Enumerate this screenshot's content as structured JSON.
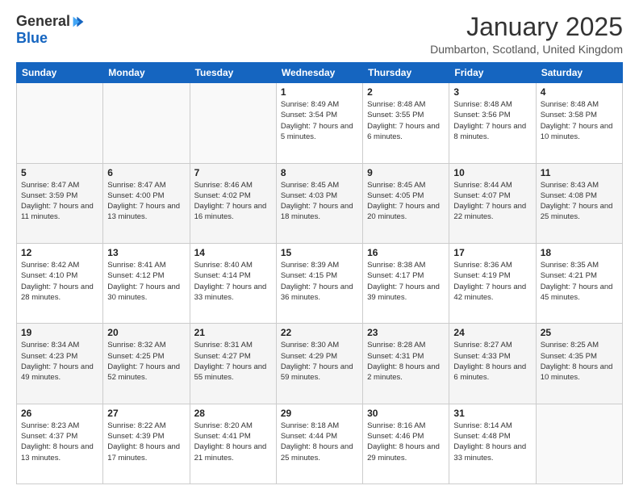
{
  "logo": {
    "general": "General",
    "blue": "Blue"
  },
  "title": "January 2025",
  "location": "Dumbarton, Scotland, United Kingdom",
  "days_of_week": [
    "Sunday",
    "Monday",
    "Tuesday",
    "Wednesday",
    "Thursday",
    "Friday",
    "Saturday"
  ],
  "weeks": [
    [
      {
        "day": "",
        "sunrise": "",
        "sunset": "",
        "daylight": ""
      },
      {
        "day": "",
        "sunrise": "",
        "sunset": "",
        "daylight": ""
      },
      {
        "day": "",
        "sunrise": "",
        "sunset": "",
        "daylight": ""
      },
      {
        "day": "1",
        "sunrise": "Sunrise: 8:49 AM",
        "sunset": "Sunset: 3:54 PM",
        "daylight": "Daylight: 7 hours and 5 minutes."
      },
      {
        "day": "2",
        "sunrise": "Sunrise: 8:48 AM",
        "sunset": "Sunset: 3:55 PM",
        "daylight": "Daylight: 7 hours and 6 minutes."
      },
      {
        "day": "3",
        "sunrise": "Sunrise: 8:48 AM",
        "sunset": "Sunset: 3:56 PM",
        "daylight": "Daylight: 7 hours and 8 minutes."
      },
      {
        "day": "4",
        "sunrise": "Sunrise: 8:48 AM",
        "sunset": "Sunset: 3:58 PM",
        "daylight": "Daylight: 7 hours and 10 minutes."
      }
    ],
    [
      {
        "day": "5",
        "sunrise": "Sunrise: 8:47 AM",
        "sunset": "Sunset: 3:59 PM",
        "daylight": "Daylight: 7 hours and 11 minutes."
      },
      {
        "day": "6",
        "sunrise": "Sunrise: 8:47 AM",
        "sunset": "Sunset: 4:00 PM",
        "daylight": "Daylight: 7 hours and 13 minutes."
      },
      {
        "day": "7",
        "sunrise": "Sunrise: 8:46 AM",
        "sunset": "Sunset: 4:02 PM",
        "daylight": "Daylight: 7 hours and 16 minutes."
      },
      {
        "day": "8",
        "sunrise": "Sunrise: 8:45 AM",
        "sunset": "Sunset: 4:03 PM",
        "daylight": "Daylight: 7 hours and 18 minutes."
      },
      {
        "day": "9",
        "sunrise": "Sunrise: 8:45 AM",
        "sunset": "Sunset: 4:05 PM",
        "daylight": "Daylight: 7 hours and 20 minutes."
      },
      {
        "day": "10",
        "sunrise": "Sunrise: 8:44 AM",
        "sunset": "Sunset: 4:07 PM",
        "daylight": "Daylight: 7 hours and 22 minutes."
      },
      {
        "day": "11",
        "sunrise": "Sunrise: 8:43 AM",
        "sunset": "Sunset: 4:08 PM",
        "daylight": "Daylight: 7 hours and 25 minutes."
      }
    ],
    [
      {
        "day": "12",
        "sunrise": "Sunrise: 8:42 AM",
        "sunset": "Sunset: 4:10 PM",
        "daylight": "Daylight: 7 hours and 28 minutes."
      },
      {
        "day": "13",
        "sunrise": "Sunrise: 8:41 AM",
        "sunset": "Sunset: 4:12 PM",
        "daylight": "Daylight: 7 hours and 30 minutes."
      },
      {
        "day": "14",
        "sunrise": "Sunrise: 8:40 AM",
        "sunset": "Sunset: 4:14 PM",
        "daylight": "Daylight: 7 hours and 33 minutes."
      },
      {
        "day": "15",
        "sunrise": "Sunrise: 8:39 AM",
        "sunset": "Sunset: 4:15 PM",
        "daylight": "Daylight: 7 hours and 36 minutes."
      },
      {
        "day": "16",
        "sunrise": "Sunrise: 8:38 AM",
        "sunset": "Sunset: 4:17 PM",
        "daylight": "Daylight: 7 hours and 39 minutes."
      },
      {
        "day": "17",
        "sunrise": "Sunrise: 8:36 AM",
        "sunset": "Sunset: 4:19 PM",
        "daylight": "Daylight: 7 hours and 42 minutes."
      },
      {
        "day": "18",
        "sunrise": "Sunrise: 8:35 AM",
        "sunset": "Sunset: 4:21 PM",
        "daylight": "Daylight: 7 hours and 45 minutes."
      }
    ],
    [
      {
        "day": "19",
        "sunrise": "Sunrise: 8:34 AM",
        "sunset": "Sunset: 4:23 PM",
        "daylight": "Daylight: 7 hours and 49 minutes."
      },
      {
        "day": "20",
        "sunrise": "Sunrise: 8:32 AM",
        "sunset": "Sunset: 4:25 PM",
        "daylight": "Daylight: 7 hours and 52 minutes."
      },
      {
        "day": "21",
        "sunrise": "Sunrise: 8:31 AM",
        "sunset": "Sunset: 4:27 PM",
        "daylight": "Daylight: 7 hours and 55 minutes."
      },
      {
        "day": "22",
        "sunrise": "Sunrise: 8:30 AM",
        "sunset": "Sunset: 4:29 PM",
        "daylight": "Daylight: 7 hours and 59 minutes."
      },
      {
        "day": "23",
        "sunrise": "Sunrise: 8:28 AM",
        "sunset": "Sunset: 4:31 PM",
        "daylight": "Daylight: 8 hours and 2 minutes."
      },
      {
        "day": "24",
        "sunrise": "Sunrise: 8:27 AM",
        "sunset": "Sunset: 4:33 PM",
        "daylight": "Daylight: 8 hours and 6 minutes."
      },
      {
        "day": "25",
        "sunrise": "Sunrise: 8:25 AM",
        "sunset": "Sunset: 4:35 PM",
        "daylight": "Daylight: 8 hours and 10 minutes."
      }
    ],
    [
      {
        "day": "26",
        "sunrise": "Sunrise: 8:23 AM",
        "sunset": "Sunset: 4:37 PM",
        "daylight": "Daylight: 8 hours and 13 minutes."
      },
      {
        "day": "27",
        "sunrise": "Sunrise: 8:22 AM",
        "sunset": "Sunset: 4:39 PM",
        "daylight": "Daylight: 8 hours and 17 minutes."
      },
      {
        "day": "28",
        "sunrise": "Sunrise: 8:20 AM",
        "sunset": "Sunset: 4:41 PM",
        "daylight": "Daylight: 8 hours and 21 minutes."
      },
      {
        "day": "29",
        "sunrise": "Sunrise: 8:18 AM",
        "sunset": "Sunset: 4:44 PM",
        "daylight": "Daylight: 8 hours and 25 minutes."
      },
      {
        "day": "30",
        "sunrise": "Sunrise: 8:16 AM",
        "sunset": "Sunset: 4:46 PM",
        "daylight": "Daylight: 8 hours and 29 minutes."
      },
      {
        "day": "31",
        "sunrise": "Sunrise: 8:14 AM",
        "sunset": "Sunset: 4:48 PM",
        "daylight": "Daylight: 8 hours and 33 minutes."
      },
      {
        "day": "",
        "sunrise": "",
        "sunset": "",
        "daylight": ""
      }
    ]
  ]
}
